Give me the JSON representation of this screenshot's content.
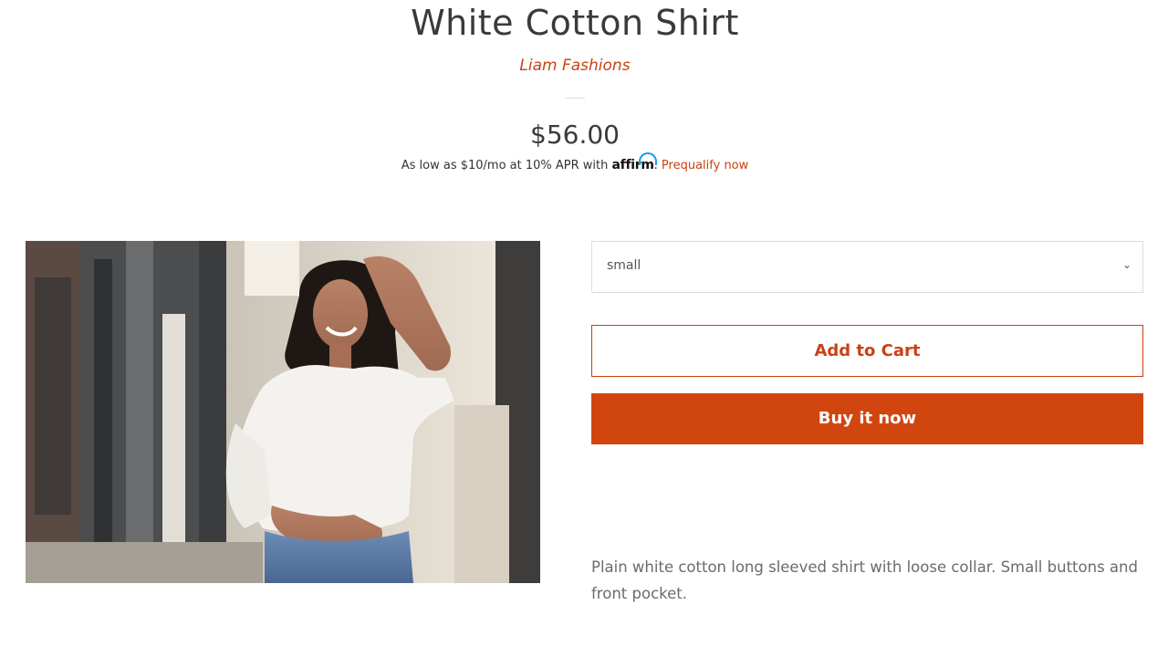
{
  "product": {
    "title": "White Cotton Shirt",
    "vendor": "Liam Fashions",
    "price": "$56.00",
    "financing": {
      "prefix": "As low as $10/mo at 10% APR with",
      "provider": "affirm",
      "separator": ".",
      "link_label": "Prequalify now"
    },
    "image": {
      "icon": "product-photo-woman-white-shirt"
    },
    "variant_select": {
      "selected": "small",
      "icon": "chevron-down-icon"
    },
    "add_to_cart_label": "Add to Cart",
    "buy_now_label": "Buy it now",
    "description": "Plain white cotton long sleeved shirt with loose collar. Small buttons and front pocket."
  },
  "colors": {
    "accent": "#c94213",
    "buy_button": "#d1460f",
    "affirm_arc": "#0fa0ea"
  }
}
